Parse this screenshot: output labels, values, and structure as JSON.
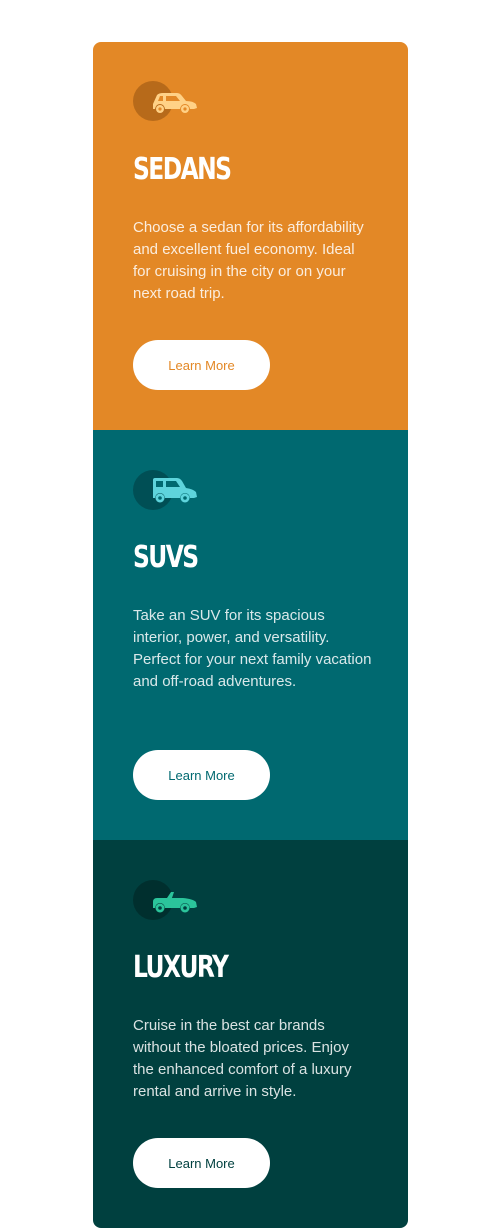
{
  "cards": [
    {
      "id": "sedans",
      "icon": "sedan-car-icon",
      "title": "SEDANS",
      "description": "Choose a sedan for its affordability and excellent fuel economy. Ideal for cruising in the city or on your next road trip.",
      "button_label": "Learn More",
      "color": "#e38826"
    },
    {
      "id": "suvs",
      "icon": "suv-car-icon",
      "title": "SUVS",
      "description": "Take an SUV for its spacious interior, power, and versatility. Perfect for your next family vacation and off-road adventures.",
      "button_label": "Learn More",
      "color": "#006970"
    },
    {
      "id": "luxury",
      "icon": "luxury-car-icon",
      "title": "LUXURY",
      "description": "Cruise in the best car brands without the bloated prices. Enjoy the enhanced comfort of a luxury rental and arrive in style.",
      "button_label": "Learn More",
      "color": "#00403f"
    }
  ]
}
